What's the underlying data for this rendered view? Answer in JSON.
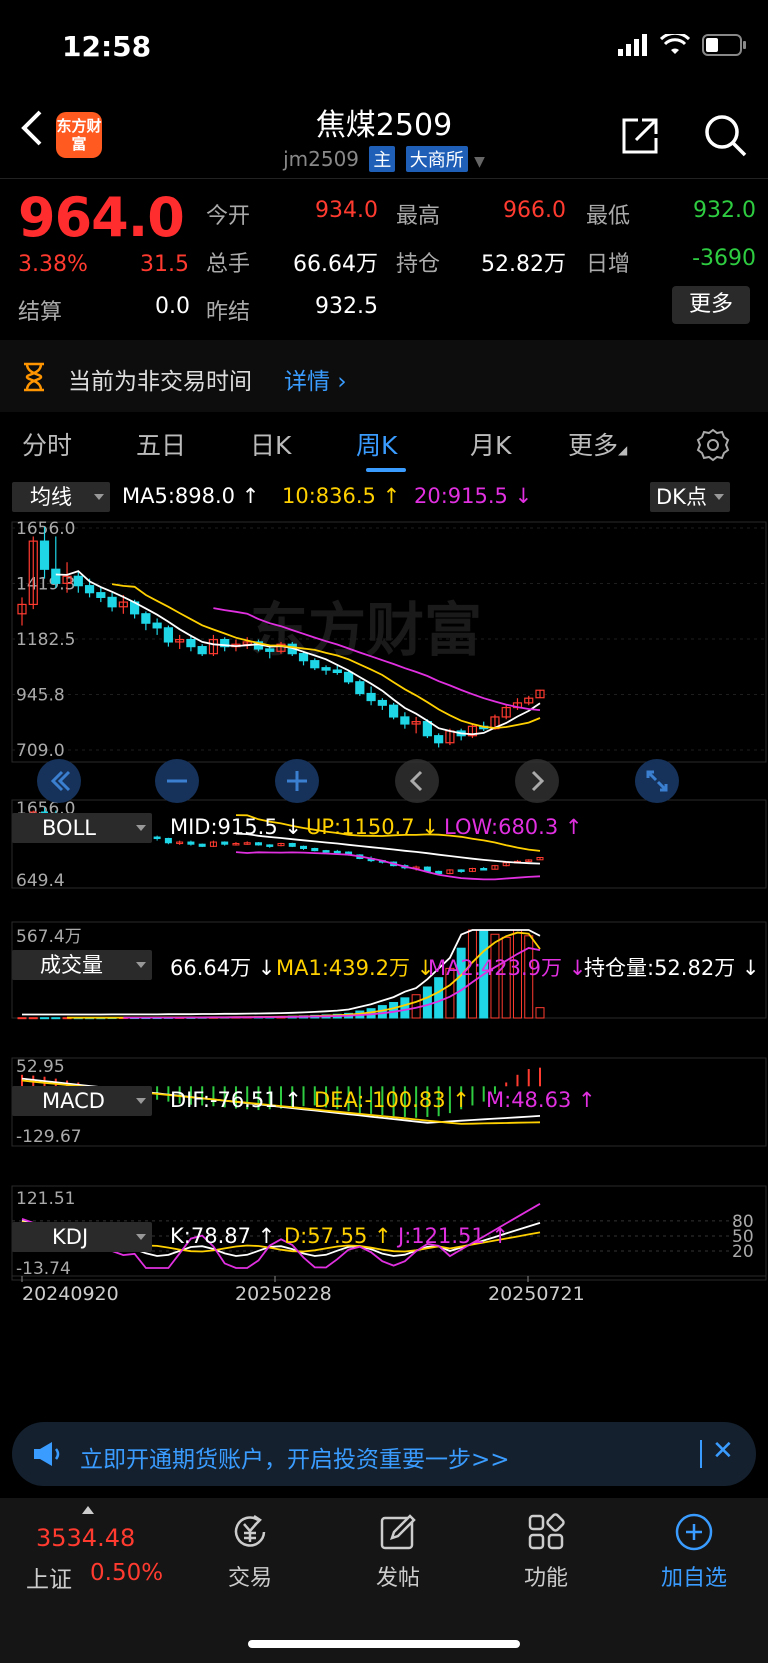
{
  "status": {
    "time": "12:58"
  },
  "header": {
    "title": "焦煤2509",
    "code": "jm2509",
    "tag_main": "主",
    "tag_exchange": "大商所",
    "logo_text": "东方财富"
  },
  "quote": {
    "price": "964.0",
    "pct": "3.38%",
    "change": "31.5",
    "open_label": "今开",
    "open": "934.0",
    "high_label": "最高",
    "high": "966.0",
    "low_label": "最低",
    "low": "932.0",
    "volume_label": "总手",
    "volume": "66.64万",
    "oi_label": "持仓",
    "oi": "52.82万",
    "daily_inc_label": "日增",
    "daily_inc": "-3690",
    "settle_label": "结算",
    "settle": "0.0",
    "prev_settle_label": "昨结",
    "prev_settle": "932.5",
    "more": "更多"
  },
  "notice": {
    "text": "当前为非交易时间",
    "link": "详情"
  },
  "tabs": [
    "分时",
    "五日",
    "日K",
    "周K",
    "月K",
    "更多"
  ],
  "active_tab": "周K",
  "indicators": {
    "ma": {
      "select": "均线",
      "ma5": "MA5:898.0",
      "ma10": "10:836.5",
      "ma20": "20:915.5",
      "dk": "DK点"
    },
    "boll": {
      "select": "BOLL",
      "mid": "MID:915.5",
      "up": "UP:1150.7",
      "low": "LOW:680.3"
    },
    "vol": {
      "select": "成交量",
      "v": "66.64万",
      "ma1": "MA1:439.2万",
      "ma2": "MA2:423.9万",
      "oi": "持仓量:52.82万"
    },
    "macd": {
      "select": "MACD",
      "dif": "DIF:-76.51",
      "dea": "DEA:-100.83",
      "m": "M:48.63"
    },
    "kdj": {
      "select": "KDJ",
      "k": "K:78.87",
      "d": "D:57.55",
      "j": "J:121.51"
    }
  },
  "chart_data": {
    "type": "candlestick",
    "price_axis_labels": [
      "1656.0",
      "1419.3",
      "1182.5",
      "945.8",
      "709.0"
    ],
    "boll_axis_labels": [
      "1656.0",
      "649.4"
    ],
    "vol_axis_label": "567.4万",
    "macd_axis_labels": [
      "52.95",
      "-129.67"
    ],
    "kdj_axis_labels": [
      "121.51",
      "-13.74"
    ],
    "kdj_levels": [
      "80",
      "50",
      "20"
    ],
    "date_labels": [
      "20240920",
      "20250228",
      "20250721"
    ],
    "watermark": "东方财富",
    "candles": [
      [
        1290,
        1360,
        1240,
        1330
      ],
      [
        1330,
        1620,
        1310,
        1600
      ],
      [
        1600,
        1660,
        1440,
        1480
      ],
      [
        1480,
        1620,
        1400,
        1420
      ],
      [
        1420,
        1510,
        1380,
        1450
      ],
      [
        1450,
        1470,
        1380,
        1410
      ],
      [
        1410,
        1440,
        1360,
        1380
      ],
      [
        1380,
        1400,
        1340,
        1360
      ],
      [
        1360,
        1380,
        1300,
        1320
      ],
      [
        1320,
        1370,
        1290,
        1340
      ],
      [
        1340,
        1350,
        1270,
        1290
      ],
      [
        1290,
        1300,
        1220,
        1250
      ],
      [
        1250,
        1270,
        1200,
        1230
      ],
      [
        1230,
        1240,
        1150,
        1170
      ],
      [
        1170,
        1200,
        1140,
        1180
      ],
      [
        1180,
        1200,
        1130,
        1150
      ],
      [
        1150,
        1160,
        1110,
        1120
      ],
      [
        1120,
        1200,
        1110,
        1180
      ],
      [
        1180,
        1190,
        1130,
        1150
      ],
      [
        1150,
        1180,
        1130,
        1160
      ],
      [
        1160,
        1190,
        1140,
        1170
      ],
      [
        1170,
        1180,
        1130,
        1140
      ],
      [
        1140,
        1150,
        1100,
        1130
      ],
      [
        1130,
        1170,
        1120,
        1160
      ],
      [
        1160,
        1170,
        1110,
        1120
      ],
      [
        1120,
        1130,
        1070,
        1090
      ],
      [
        1090,
        1100,
        1050,
        1060
      ],
      [
        1060,
        1070,
        1030,
        1050
      ],
      [
        1050,
        1070,
        1030,
        1040
      ],
      [
        1040,
        1050,
        990,
        1000
      ],
      [
        1000,
        1010,
        940,
        950
      ],
      [
        950,
        980,
        900,
        920
      ],
      [
        920,
        930,
        880,
        900
      ],
      [
        900,
        910,
        840,
        850
      ],
      [
        850,
        870,
        800,
        820
      ],
      [
        820,
        850,
        780,
        830
      ],
      [
        830,
        840,
        760,
        770
      ],
      [
        770,
        780,
        720,
        740
      ],
      [
        740,
        800,
        730,
        790
      ],
      [
        790,
        800,
        750,
        770
      ],
      [
        770,
        820,
        760,
        810
      ],
      [
        810,
        830,
        790,
        800
      ],
      [
        800,
        860,
        795,
        850
      ],
      [
        850,
        900,
        840,
        890
      ],
      [
        890,
        930,
        880,
        910
      ],
      [
        910,
        940,
        900,
        930
      ],
      [
        932,
        966,
        932,
        964
      ]
    ],
    "volume_wan": [
      2,
      2,
      2,
      2,
      2,
      2,
      2,
      2,
      3,
      3,
      3,
      3,
      3,
      4,
      4,
      4,
      5,
      5,
      6,
      6,
      7,
      8,
      9,
      10,
      12,
      14,
      17,
      20,
      24,
      30,
      45,
      60,
      80,
      100,
      130,
      150,
      200,
      260,
      320,
      450,
      567,
      560,
      540,
      520,
      567,
      530,
      66.64
    ],
    "macd_hist": [
      30,
      28,
      25,
      20,
      15,
      10,
      -5,
      -10,
      -15,
      -20,
      -25,
      -30,
      -35,
      -40,
      -45,
      -48,
      -50,
      -52,
      -55,
      -58,
      -60,
      -62,
      -60,
      -58,
      -55,
      -52,
      -50,
      -55,
      -60,
      -65,
      -70,
      -72,
      -75,
      -78,
      -80,
      -82,
      -80,
      -78,
      -70,
      -60,
      -50,
      -40,
      -20,
      10,
      30,
      45,
      48.63
    ]
  },
  "banner": {
    "text": "立即开通期货账户，开启投资重要一步>>"
  },
  "bottom": {
    "index_value": "3534.48",
    "index_name": "上证",
    "index_pct": "0.50%",
    "nav": [
      "交易",
      "发帖",
      "功能",
      "加自选"
    ]
  }
}
